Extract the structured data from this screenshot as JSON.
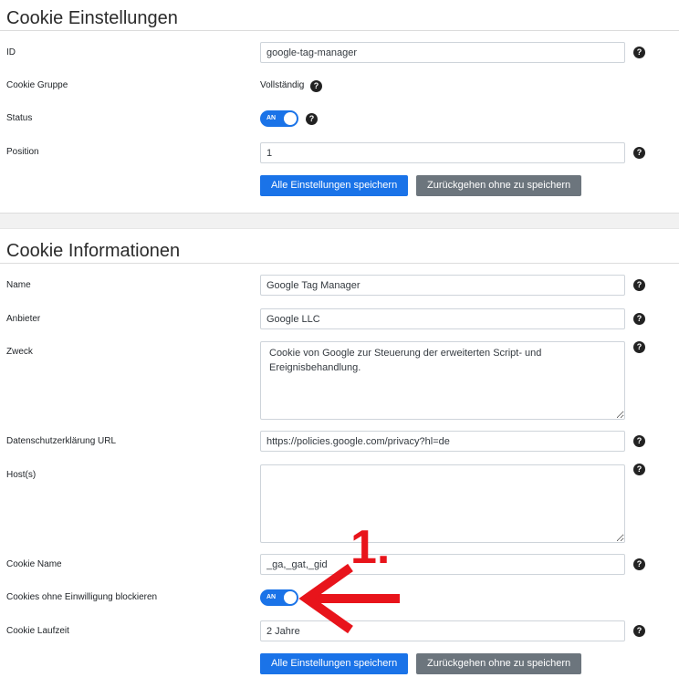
{
  "settings": {
    "title": "Cookie Einstellungen",
    "id_label": "ID",
    "id_value": "google-tag-manager",
    "group_label": "Cookie Gruppe",
    "group_value": "Vollständig",
    "status_label": "Status",
    "status_toggle": "AN",
    "status_on": true,
    "position_label": "Position",
    "position_value": "1",
    "save_label": "Alle Einstellungen speichern",
    "back_label": "Zurückgehen ohne zu speichern"
  },
  "info": {
    "title": "Cookie Informationen",
    "name_label": "Name",
    "name_value": "Google Tag Manager",
    "provider_label": "Anbieter",
    "provider_value": "Google LLC",
    "purpose_label": "Zweck",
    "purpose_value": "Cookie von Google zur Steuerung der erweiterten Script- und Ereignisbehandlung.",
    "privacy_label": "Datenschutzerklärung URL",
    "privacy_value": "https://policies.google.com/privacy?hl=de",
    "hosts_label": "Host(s)",
    "hosts_value": "",
    "cookie_name_label": "Cookie Name",
    "cookie_name_value": "_ga,_gat,_gid",
    "block_label": "Cookies ohne Einwilligung blockieren",
    "block_toggle": "AN",
    "block_on": true,
    "lifetime_label": "Cookie Laufzeit",
    "lifetime_value": "2 Jahre",
    "save_label": "Alle Einstellungen speichern",
    "back_label": "Zurückgehen ohne zu speichern"
  },
  "help_glyph": "?",
  "annotation": {
    "step_number": "1.",
    "color": "#e8141b"
  },
  "colors": {
    "primary": "#1a73e8",
    "secondary": "#6c757d"
  }
}
